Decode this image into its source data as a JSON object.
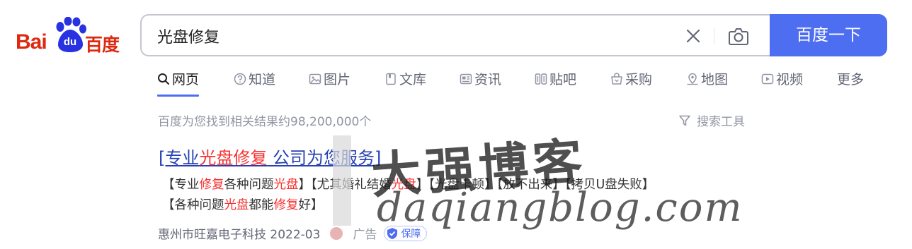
{
  "logo": {
    "latin": "Bai",
    "du": "du",
    "chinese": "百度"
  },
  "search": {
    "query": "光盘修复",
    "button_label": "百度一下",
    "clear_icon": "close-icon",
    "image_search_icon": "camera-icon"
  },
  "tabs": [
    {
      "label": "网页",
      "icon": "search-icon",
      "active": true
    },
    {
      "label": "知道",
      "icon": "question-icon"
    },
    {
      "label": "图片",
      "icon": "image-icon"
    },
    {
      "label": "文库",
      "icon": "document-icon"
    },
    {
      "label": "资讯",
      "icon": "news-icon"
    },
    {
      "label": "贴吧",
      "icon": "tieba-icon"
    },
    {
      "label": "采购",
      "icon": "basket-icon"
    },
    {
      "label": "地图",
      "icon": "map-pin-icon"
    },
    {
      "label": "视频",
      "icon": "play-icon"
    },
    {
      "label": "更多"
    }
  ],
  "results_info": {
    "count_text": "百度为您找到相关结果约98,200,000个",
    "tools_label": "搜索工具"
  },
  "result": {
    "title_prefix": "[专业",
    "title_highlight": "光盘修复",
    "title_suffix": " 公司为您服务]",
    "abstract_line1": [
      {
        "text": "【专业"
      },
      {
        "text": "修复",
        "hl": true
      },
      {
        "text": "各种问题"
      },
      {
        "text": "光盘",
        "hl": true
      },
      {
        "text": "】【尤其婚礼结婚"
      },
      {
        "text": "光盘",
        "hl": true
      },
      {
        "text": "】【光盘卡顿】【放不出来】【拷贝U盘失败】"
      }
    ],
    "abstract_line2": [
      {
        "text": "【各种问题"
      },
      {
        "text": "光盘",
        "hl": true
      },
      {
        "text": "都能"
      },
      {
        "text": "修复",
        "hl": true
      },
      {
        "text": "好】"
      }
    ],
    "source": "惠州市旺嘉电子科技 2022-03",
    "ad_label": "广告",
    "badge_label": "保障"
  },
  "watermark": {
    "title": "大强博客",
    "url": "daqiangblog.com"
  },
  "colors": {
    "brand_blue": "#4e6ef2",
    "link_blue": "#2440b3",
    "highlight_red": "#f73131",
    "logo_red": "#de2910",
    "logo_blue": "#2932e1"
  }
}
